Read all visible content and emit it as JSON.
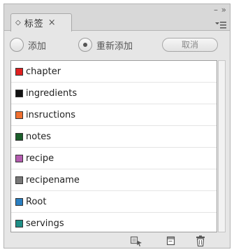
{
  "panel": {
    "tab": {
      "label": "标签",
      "close": "×"
    },
    "window_controls": {
      "minimize": "–",
      "collapse": "»"
    },
    "menu_icon": "panel-menu-icon"
  },
  "toolbar": {
    "add_label": "添加",
    "readd_label": "重新添加",
    "readd_selected": true,
    "cancel_label": "取消"
  },
  "tags": [
    {
      "name": "chapter",
      "color": "#e02020"
    },
    {
      "name": "ingredients",
      "color": "#111111"
    },
    {
      "name": "insructions",
      "color": "#f07030"
    },
    {
      "name": "notes",
      "color": "#1a5e2a"
    },
    {
      "name": "recipe",
      "color": "#b45cb0"
    },
    {
      "name": "recipename",
      "color": "#777777"
    },
    {
      "name": "Root",
      "color": "#2a7fc2"
    },
    {
      "name": "servings",
      "color": "#1f8f87"
    }
  ],
  "bottom_icons": [
    "new-tag-from-selection-icon",
    "new-tag-icon",
    "trash-icon"
  ]
}
